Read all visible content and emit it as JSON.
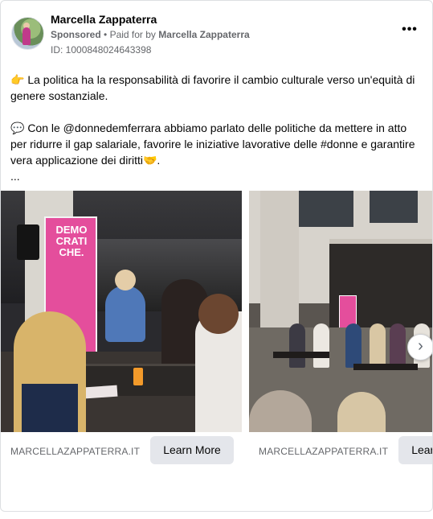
{
  "ad": {
    "page_name": "Marcella Zappaterra",
    "sponsored_label": "Sponsored",
    "paid_for_prefix": "Paid for by",
    "paid_for_name": "Marcella Zappaterra",
    "ad_id": "ID: 1000848024643398",
    "more_icon": "more-horizontal-icon"
  },
  "body": {
    "paragraph1": "👉 La politica ha la responsabilità di favorire il cambio culturale verso un'equità di genere sostanziale.",
    "paragraph2": "💬 Con le @donnedemferrara abbiamo parlato delle politiche da mettere in atto per ridurre il gap salariale, favorire le iniziative lavorative delle #donne e garantire vera applicazione dei diritti🤝.",
    "ellipsis": "..."
  },
  "carousel": {
    "cards": [
      {
        "domain": "MARCELLAZAPPATERRA.IT",
        "cta": "Learn More",
        "banner_text": "DEMO CRATI CHE."
      },
      {
        "domain": "MARCELLAZAPPATERRA.IT",
        "cta": "Learn More"
      }
    ],
    "next_icon": "chevron-right-icon",
    "next_glyph": "›"
  },
  "colors": {
    "banner_pink": "#e44e9c",
    "cta_background": "#e4e6eb",
    "secondary_text": "#65676b"
  }
}
